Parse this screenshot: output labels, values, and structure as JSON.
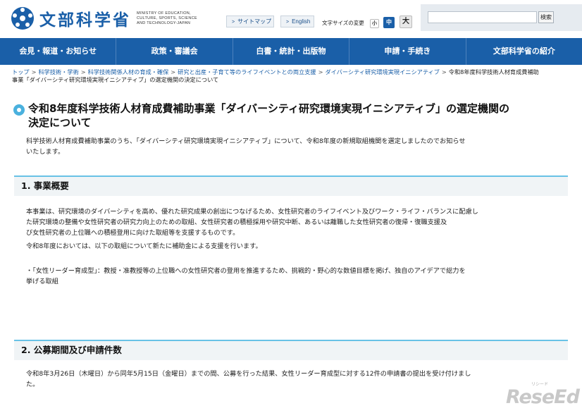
{
  "header": {
    "logo_text": "文部科学省",
    "logo_sub": "MINISTRY OF EDUCATION, CULTURE, SPORTS, SCIENCE AND TECHNOLOGY-JAPAN",
    "sitemap_label": "サイトマップ",
    "english_label": "English",
    "font_size_label": "文字サイズの変更",
    "font_small": "小",
    "font_mid": "中",
    "font_large": "大",
    "search_placeholder": "",
    "search_button": "検索"
  },
  "nav": {
    "items": [
      {
        "label": "会見・報道・お知らせ"
      },
      {
        "label": "政策・審議会"
      },
      {
        "label": "白書・統計・出版物"
      },
      {
        "label": "申請・手続き"
      },
      {
        "label": "文部科学省の紹介"
      }
    ]
  },
  "breadcrumb": {
    "items": [
      "トップ",
      "科学技術・学術",
      "科学技術関係人材の育成・確保",
      "研究と出産・子育て等のライフイベントとの両立支援",
      "ダイバーシティ研究環境実現イニシアティブ"
    ],
    "current_1": "令和8年度科学技術人材育成費補助",
    "current_2": "事業「ダイバーシティ研究環境実現イニシアティブ」の選定機関の決定について",
    "separator": ">"
  },
  "page": {
    "title_line1": "令和8年度科学技術人材育成費補助事業「ダイバーシティ研究環境実現イニシアティブ」の選定機関の",
    "title_line2": "決定について",
    "lead_line1": "科学技術人材育成費補助事業のうち、「ダイバーシティ研究環境実現イニシアティブ」について、令和8年度の新規取組機関を選定しましたのでお知らせ",
    "lead_line2": "いたします。"
  },
  "section1": {
    "heading": "1. 事業概要",
    "p1_line1": "本事業は、研究環境のダイバーシティを高め、優れた研究成果の創出につなげるため、女性研究者のライフイベント及びワーク・ライフ・バランスに配慮し",
    "p1_line2": "た研究環境の整備や女性研究者の研究力向上のための取組、女性研究者の積極採用や研究中断、あるいは離職した女性研究者の復帰・復職支援及",
    "p1_line3": "び女性研究者の上位職への積極登用に向けた取組等を支援するものです。",
    "p2": "令和8年度においては、以下の取組について新たに補助金による支援を行います。",
    "p3_line1": "・「女性リーダー育成型」：教授・准教授等の上位職への女性研究者の登用を推進するため、挑戦的・野心的な数値目標を掲げ、独自のアイデアで総力を",
    "p3_line2": "挙げる取組"
  },
  "section2": {
    "heading": "2. 公募期間及び申請件数",
    "p1_line1": "令和8年3月26日（木曜日）から同年5月15日（金曜日）までの間、公募を行った結果、女性リーダー育成型に対する12件の申請書の提出を受け付けまし",
    "p1_line2": "た。"
  },
  "watermark": {
    "text": "ReseEd",
    "sub": "リシード"
  },
  "colors": {
    "brand_blue": "#1a5fa8",
    "accent_cyan": "#4ab1de",
    "section_bg": "#f0f4f6"
  }
}
